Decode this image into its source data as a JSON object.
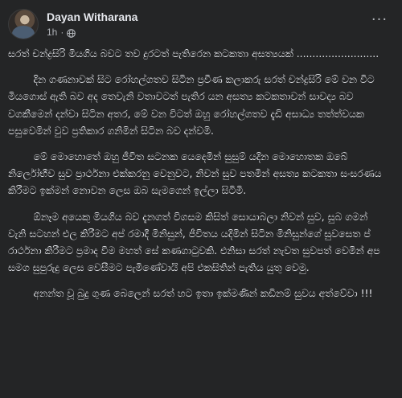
{
  "post": {
    "author": "Dayan Witharana",
    "time": "1h",
    "separator": "·",
    "privacy_icon": "globe-icon",
    "menu_icon": "more-options-icon",
    "paragraphs": [
      "සරත් චන්ද්‍රසිරි මියගිය බවට තව දුරටත් පැතිරෙන කටකතා අසත්‍යයක් ..........................",
      "        දින ගණනාවක් සිට රෝහල්ගතව සිටින ප්‍රවීණ කලාකරු සරත් චන්ද්‍රසිරි මේ වන විට මියගොස් ඇති බව අද තෙවැනි වතාවටත් පැතිර යන අසත්‍ය කටකතාවන් සාවද්‍ය බව වගකීමෙන් දන්වා සිටින අතර, මේ වන විටත් ඔහු රෝහල්ගතව දැඩි අසාධ්‍ය තත්ත්වයක පසුවෙමින් වුව ප්‍රතිකාර ගනිමින් සිටින බව දන්වමි.",
      "        මේ මොහොතේ ඔහු ජීවිත සටනක යෙදෙමින් සුසුම් යදින මොහොතක ඔබේ නිර්ලෝභීව සුව ප්‍රාර්ථනා එක්කරනු වෙනුවට, නිවන් සුව පතමින් අසත්‍ය කටකතා සංසරණය කිරීමට ඉක්මන් නොවන ලෙස ඔබ සැමගෙන් ඉල්ලා සිටිමි.",
      "        ඕනෑම අයෙකු මියගිය බව දැනගත් විගසම කිසිත් සොයාබලා නිවන් සුව, සුබ ගමන් වැනි සටහන් එල කිරීමට අප් රමාදී මිනිසුන්, ජීවිතය යදිමින් සිටින මිනිසුන්ගේ සුවසෙත ප් රාර්ථනා කිරීමට ප්‍රමාද වීම මහත් සේ කණගාටුවකි. එනිසා සරත් නැවත සුවපත් වෙමින් අප සමග සුපුරුදු ලෙස වෙසීමට පැමිණේවායි අපි එකසිතින් පැතිය යුතු වෙමු.",
      "        අනන්ත වූ බුදු ගුණ බෙලෙන් සරත් හට ඉතා ඉක්මණින් කඩිනම් සුවය අත්වේවා !!!"
    ]
  },
  "colors": {
    "background": "#242526",
    "primary_text": "#e4e6eb",
    "secondary_text": "#b0b3b8"
  }
}
